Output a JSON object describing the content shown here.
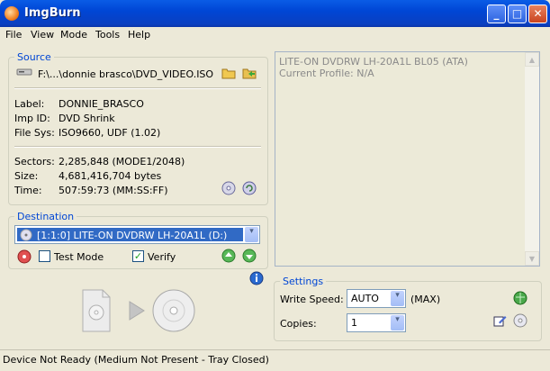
{
  "window": {
    "title": "ImgBurn",
    "minimize": "_",
    "maximize": "□",
    "close": "✕"
  },
  "menu": [
    "File",
    "View",
    "Mode",
    "Tools",
    "Help"
  ],
  "source": {
    "title": "Source",
    "path": "F:\\...\\donnie brasco\\DVD_VIDEO.ISO",
    "label_key": "Label:",
    "label_val": "DONNIE_BRASCO",
    "impid_key": "Imp ID:",
    "impid_val": "DVD Shrink",
    "filesys_key": "File Sys:",
    "filesys_val": "ISO9660, UDF (1.02)",
    "sectors_key": "Sectors:",
    "sectors_val": "2,285,848 (MODE1/2048)",
    "size_key": "Size:",
    "size_val": "4,681,416,704 bytes",
    "time_key": "Time:",
    "time_val": "507:59:73 (MM:SS:FF)"
  },
  "destination": {
    "title": "Destination",
    "drive": "[1:1:0] LITE-ON DVDRW LH-20A1L (D:)",
    "test_mode": "Test Mode",
    "test_mode_checked": false,
    "verify": "Verify",
    "verify_checked": true
  },
  "log": {
    "line1": "LITE-ON DVDRW LH-20A1L BL05 (ATA)",
    "line2": "Current Profile: N/A"
  },
  "settings": {
    "title": "Settings",
    "write_speed_label": "Write Speed:",
    "write_speed": "AUTO",
    "write_speed_max": "(MAX)",
    "copies_label": "Copies:",
    "copies": "1"
  },
  "status": "Device Not Ready (Medium Not Present - Tray Closed)",
  "icons": {
    "check": "✓",
    "arrow": "▾",
    "scroll_up": "▲",
    "scroll_down": "▼"
  },
  "colors": {
    "title_bar": "#0046d5",
    "group_title": "#0046d5",
    "selection": "#316ac5"
  }
}
